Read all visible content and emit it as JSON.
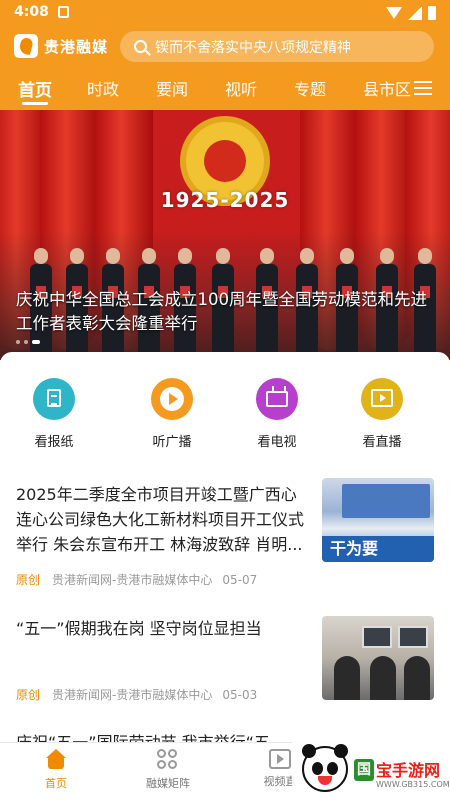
{
  "status_bar": {
    "time": "4:08"
  },
  "header": {
    "app_name": "贵港融媒",
    "search_placeholder": "锲而不舍落实中央八项规定精神"
  },
  "tabs": [
    {
      "label": "首页"
    },
    {
      "label": "时政"
    },
    {
      "label": "要闻"
    },
    {
      "label": "视听"
    },
    {
      "label": "专题"
    },
    {
      "label": "县市区"
    }
  ],
  "banner": {
    "year_text": "1925-2025",
    "caption": "庆祝中华全国总工会成立100周年暨全国劳动模范和先进工作者表彰大会隆重举行"
  },
  "quick_links": [
    {
      "label": "看报纸",
      "color": "#2fb5c8",
      "icon": "newspaper-icon"
    },
    {
      "label": "听广播",
      "color": "#f49a1e",
      "icon": "radio-play-icon"
    },
    {
      "label": "看电视",
      "color": "#b63fce",
      "icon": "tv-icon"
    },
    {
      "label": "看直播",
      "color": "#e2b21a",
      "icon": "live-icon"
    }
  ],
  "news": [
    {
      "title": "2025年二季度全市项目开竣工暨广西心连心公司绿色大化工新材料项目开工仪式举行 朱会东宣布开工 林海波致辞 肖明...",
      "tag": "原创",
      "source": "贵港新闻网-贵港市融媒体中心",
      "date": "05-07",
      "thumb_slogan": "干为要"
    },
    {
      "title": "“五一”假期我在岗 坚守岗位显担当",
      "tag": "原创",
      "source": "贵港新闻网-贵港市融媒体中心",
      "date": "05-03"
    },
    {
      "title": "庆祝“五一”国际劳动节 我市举行“五"
    }
  ],
  "bottom_nav": [
    {
      "label": "首页"
    },
    {
      "label": "融媒矩阵"
    },
    {
      "label": "视频直"
    }
  ],
  "watermark": {
    "badge": "国",
    "text": "宝手游网",
    "sub": "WWW.GB315.COM"
  },
  "colors": {
    "accent": "#f49a1e",
    "tag": "#f08a00"
  }
}
